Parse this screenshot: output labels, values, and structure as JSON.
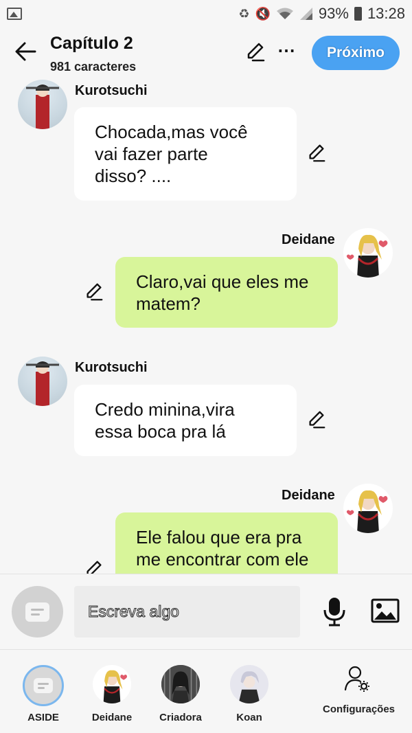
{
  "status_bar": {
    "battery_percent": "93%",
    "time": "13:28",
    "icons": [
      "gallery-icon",
      "battery-saver-icon",
      "mute-icon",
      "wifi-icon",
      "signal-icon",
      "battery-icon"
    ]
  },
  "header": {
    "title": "Capítulo 2",
    "subtitle": "981 caracteres",
    "next_label": "Próximo",
    "more_label": "⋯"
  },
  "messages": [
    {
      "side": "left",
      "sender": "Kurotsuchi",
      "lines": [
        "Chocada,mas você",
        "vai fazer parte",
        "disso? ...."
      ]
    },
    {
      "side": "right",
      "sender": "Deidane",
      "lines": [
        "Claro,vai que eles me",
        "matem?"
      ]
    },
    {
      "side": "left",
      "sender": "Kurotsuchi",
      "lines": [
        "Credo minina,vira",
        "essa boca pra lá"
      ]
    },
    {
      "side": "right",
      "sender": "Deidane",
      "lines": [
        "Ele falou que era pra",
        "me encontrar com ele"
      ]
    }
  ],
  "composer": {
    "placeholder": "Escreva algo"
  },
  "bottom_bar": {
    "tabs": [
      {
        "label": "ASIDE"
      },
      {
        "label": "Deidane"
      },
      {
        "label": "Criadora"
      },
      {
        "label": "Koan"
      },
      {
        "label": "Configurações"
      }
    ]
  },
  "colors": {
    "accent": "#4aa2f2",
    "right_bubble": "#d8f59a",
    "left_bubble": "#ffffff",
    "background": "#f6f6f6"
  }
}
